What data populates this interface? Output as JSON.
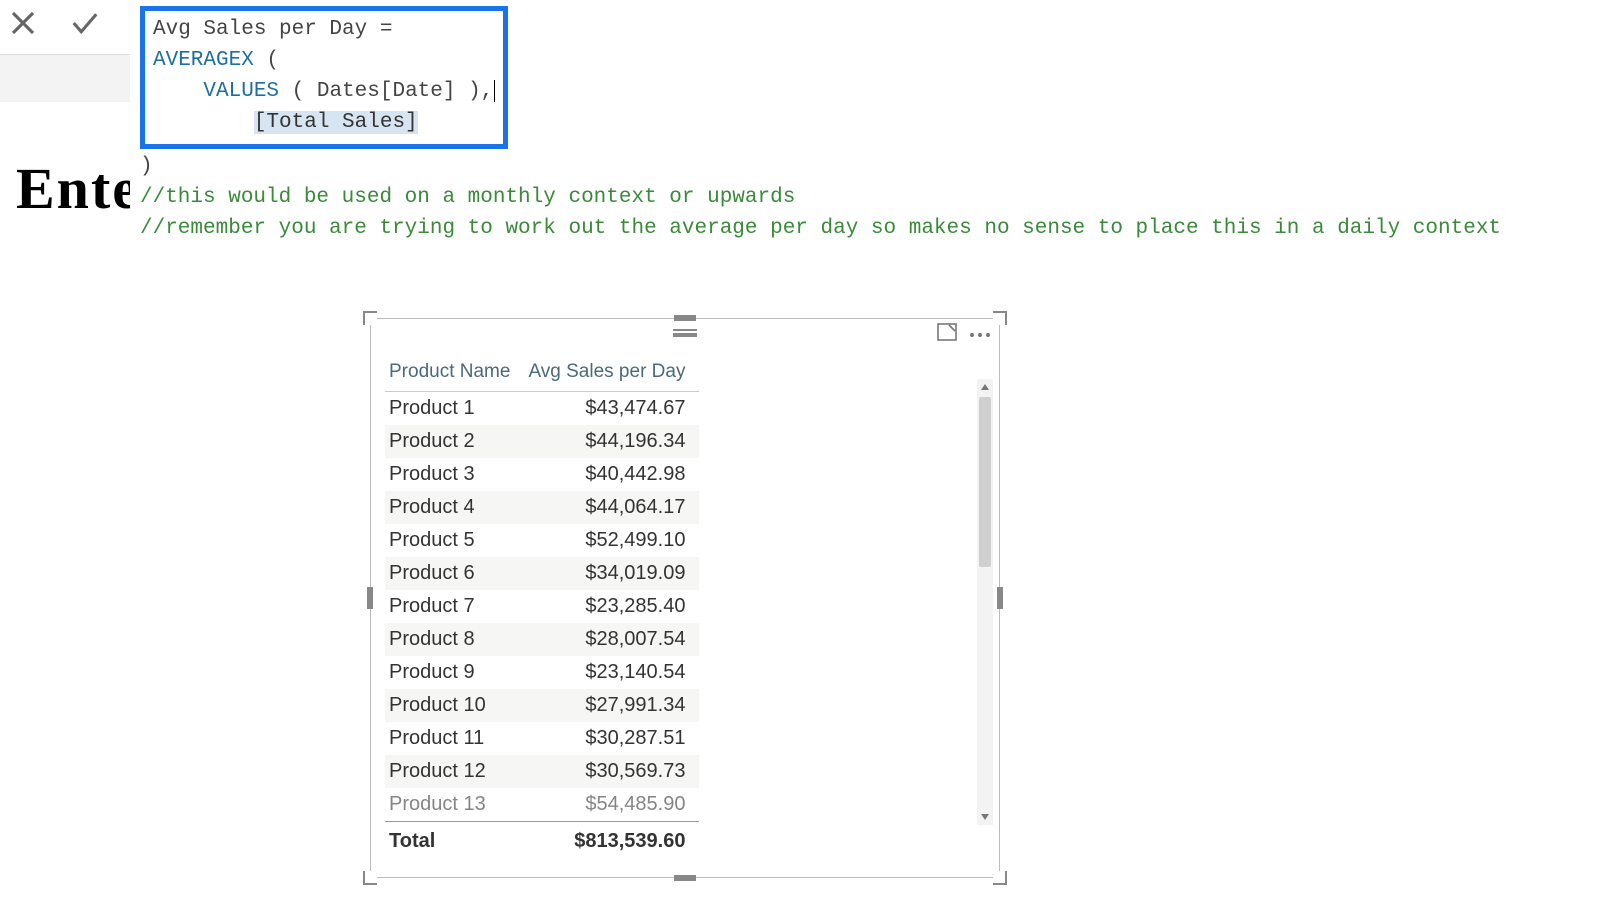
{
  "toolbar": {
    "cancel_icon": "close-icon",
    "commit_icon": "check-icon"
  },
  "formula": {
    "line1_name": "Avg Sales per Day =",
    "line2_func": "AVERAGEX",
    "line2_rest": " (",
    "line3_func": "VALUES",
    "line3_rest": " ( Dates[Date] ),",
    "line4_measure": "[Total Sales]",
    "line5": ")",
    "comment1": "//this would be used on a monthly context or upwards",
    "comment2": "//remember you are trying to work out the average per day so makes no sense to place this in a daily context"
  },
  "background_title": "Ente",
  "table": {
    "headers": {
      "col1": "Product Name",
      "col2": "Avg Sales per Day"
    },
    "rows": [
      {
        "name": "Product 1",
        "value": "$43,474.67"
      },
      {
        "name": "Product 2",
        "value": "$44,196.34"
      },
      {
        "name": "Product 3",
        "value": "$40,442.98"
      },
      {
        "name": "Product 4",
        "value": "$44,064.17"
      },
      {
        "name": "Product 5",
        "value": "$52,499.10"
      },
      {
        "name": "Product 6",
        "value": "$34,019.09"
      },
      {
        "name": "Product 7",
        "value": "$23,285.40"
      },
      {
        "name": "Product 8",
        "value": "$28,007.54"
      },
      {
        "name": "Product 9",
        "value": "$23,140.54"
      },
      {
        "name": "Product 10",
        "value": "$27,991.34"
      },
      {
        "name": "Product 11",
        "value": "$30,287.51"
      },
      {
        "name": "Product 12",
        "value": "$30,569.73"
      },
      {
        "name": "Product 13",
        "value": "$54,485.90"
      }
    ],
    "total_label": "Total",
    "total_value": "$813,539.60"
  }
}
